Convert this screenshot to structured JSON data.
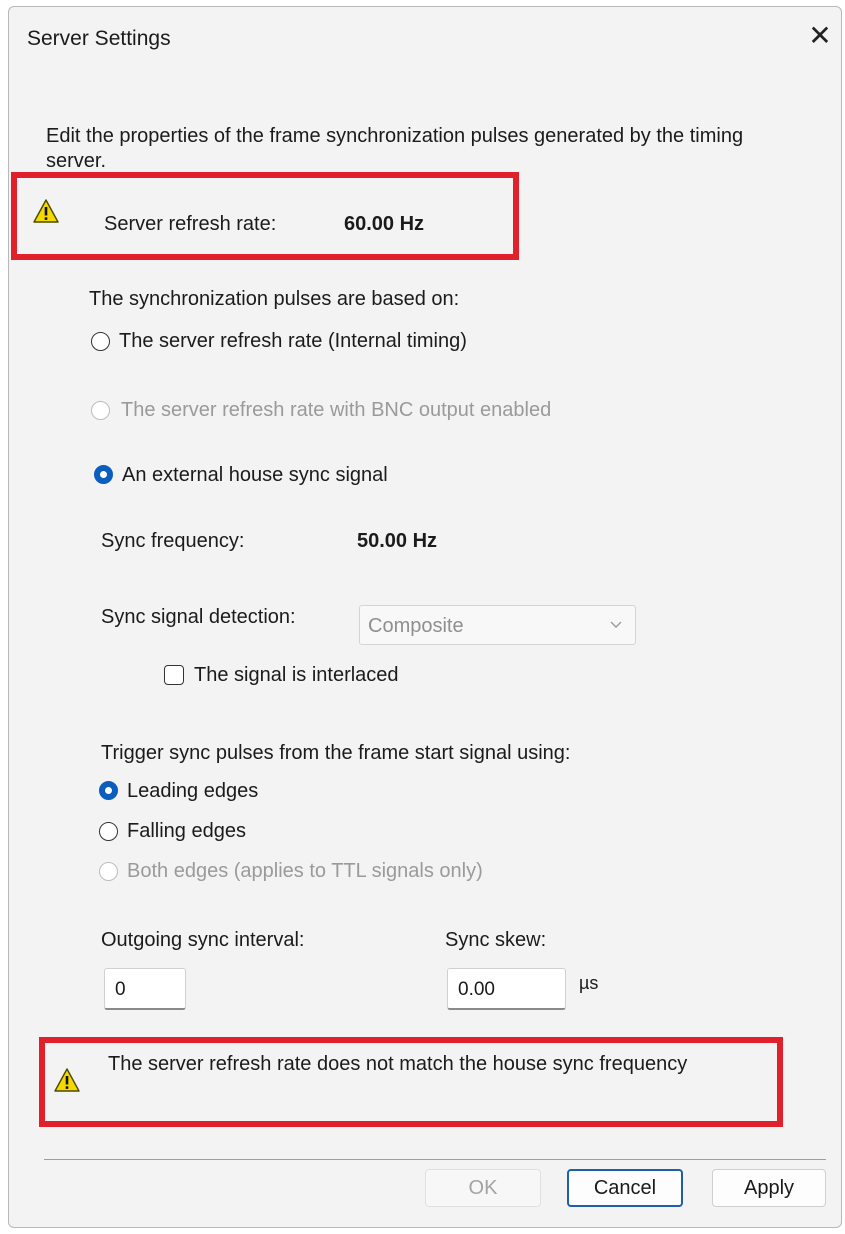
{
  "window": {
    "title": "Server Settings",
    "close_glyph": "✕"
  },
  "description": "Edit the properties of the frame synchronization pulses generated by the timing server.",
  "refresh": {
    "label": "Server refresh rate:",
    "value": "60.00 Hz"
  },
  "pulses": {
    "heading": "The synchronization pulses are based on:",
    "options": [
      "The server refresh rate (Internal timing)",
      "The server refresh rate with BNC output enabled",
      "An external house sync signal"
    ],
    "selected_index": 2
  },
  "sync": {
    "frequency_label": "Sync frequency:",
    "frequency_value": "50.00 Hz",
    "detection_label": "Sync signal detection:",
    "detection_value": "Composite",
    "interlaced_label": "The signal is interlaced",
    "interlaced_checked": false
  },
  "trigger": {
    "heading": "Trigger sync pulses from the frame start signal using:",
    "options": [
      "Leading edges",
      "Falling edges",
      "Both edges (applies to TTL signals only)"
    ],
    "selected_index": 0
  },
  "outgoing": {
    "label": "Outgoing sync interval:",
    "value": "0"
  },
  "skew": {
    "label": "Sync skew:",
    "value": "0.00",
    "unit": "µs"
  },
  "warning": "The server refresh rate does not match the house sync frequency",
  "buttons": {
    "ok": "OK",
    "cancel": "Cancel",
    "apply": "Apply"
  },
  "colors": {
    "accent": "#0a5ebd",
    "highlight_box": "#e0202a",
    "warning_yellow": "#f5d800"
  },
  "icons": {
    "warning": "warning-icon",
    "close": "close-icon",
    "chevron": "chevron-down-icon"
  }
}
